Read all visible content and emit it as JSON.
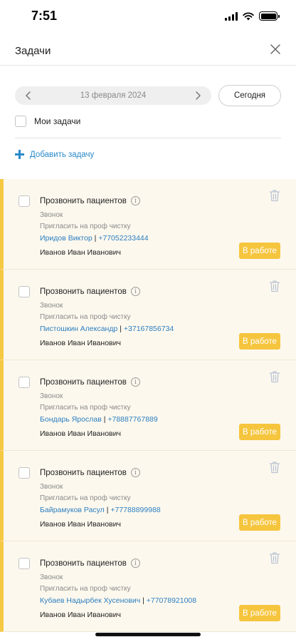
{
  "status_bar": {
    "time": "7:51",
    "wifi_icon": "wifi-icon",
    "battery_icon": "battery-icon",
    "signal_icon": "signal-icon"
  },
  "header": {
    "title": "Задачи",
    "close_icon": "close-icon"
  },
  "date_picker": {
    "date": "13 февраля 2024",
    "prev_icon": "chevron-left-icon",
    "next_icon": "chevron-right-icon",
    "today_label": "Сегодня"
  },
  "filters": {
    "my_tasks_label": "Мои задачи",
    "my_tasks_checked": false
  },
  "add_task": {
    "label": "Добавить задачу",
    "icon": "plus-icon"
  },
  "colors": {
    "accent": "#2b8ac9",
    "status": "#f6c53e",
    "card_bg": "#fdf8ee",
    "card_stripe": "#f6c944"
  },
  "tasks": [
    {
      "title": "Прозвонить пациентов",
      "type": "Звонок",
      "description": "Пригласить на проф чистку",
      "contact_name": "Иридов Виктор",
      "separator": " | ",
      "phone": "+77052233444",
      "owner": "Иванов Иван Иванович",
      "status": "В работе"
    },
    {
      "title": "Прозвонить пациентов",
      "type": "Звонок",
      "description": "Пригласить на проф чистку",
      "contact_name": "Пистошкин Александр",
      "separator": " | ",
      "phone": "+37167856734",
      "owner": "Иванов Иван Иванович",
      "status": "В работе"
    },
    {
      "title": "Прозвонить пациентов",
      "type": "Звонок",
      "description": "Пригласить на проф чистку",
      "contact_name": "Бондарь Ярослав",
      "separator": " | ",
      "phone": "+78887767889",
      "owner": "Иванов Иван Иванович",
      "status": "В работе"
    },
    {
      "title": "Прозвонить пациентов",
      "type": "Звонок",
      "description": "Пригласить на проф чистку",
      "contact_name": "Байрамуков Расул",
      "separator": " | ",
      "phone": "+77788899988",
      "owner": "Иванов Иван Иванович",
      "status": "В работе"
    },
    {
      "title": "Прозвонить пациентов",
      "type": "Звонок",
      "description": "Пригласить на проф чистку",
      "contact_name": "Кубаев Надырбек Хусенович",
      "separator": " | ",
      "phone": "+77078921008",
      "owner": "Иванов Иван Иванович",
      "status": "В работе"
    }
  ]
}
